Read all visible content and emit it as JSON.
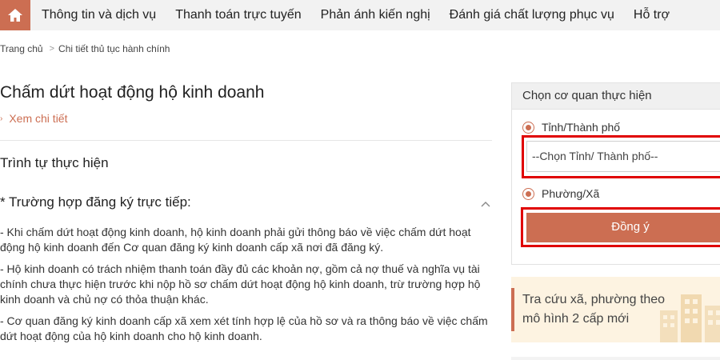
{
  "nav": {
    "items": [
      "Thông tin và dịch vụ",
      "Thanh toán trực tuyến",
      "Phản ánh kiến nghị",
      "Đánh giá chất lượng phục vụ",
      "Hỗ trợ"
    ]
  },
  "breadcrumb": {
    "home": "Trang chủ",
    "current": "Chi tiết thủ tục hành chính"
  },
  "procedure": {
    "title": "Chấm dứt hoạt động hộ kinh doanh",
    "detail_link": "Xem chi tiết",
    "section_title": "Trình tự thực hiện",
    "case_title": "* Trường hợp đăng ký trực tiếp:",
    "paragraphs": [
      "- Khi chấm dứt hoạt động kinh doanh, hộ kinh doanh phải gửi thông báo về việc chấm dứt hoạt động hộ kinh doanh đến Cơ quan đăng ký kinh doanh cấp xã nơi đã đăng ký.",
      "- Hộ kinh doanh có trách nhiệm thanh toán đầy đủ các khoản nợ, gồm cả nợ thuế và nghĩa vụ tài chính chưa thực hiện trước khi nộp hồ sơ chấm dứt hoạt động hộ kinh doanh, trừ trường hợp hộ kinh doanh và chủ nợ có thỏa thuận khác.",
      "- Cơ quan đăng ký kinh doanh cấp xã xem xét tính hợp lệ của hồ sơ và ra thông báo về việc chấm dứt hoạt động của hộ kinh doanh cho hộ kinh doanh."
    ]
  },
  "agency_panel": {
    "header": "Chọn cơ quan thực hiện",
    "option_province": "Tỉnh/Thành phố",
    "select_placeholder": "--Chọn Tỉnh/ Thành phố--",
    "option_ward": "Phường/Xã",
    "agree_button": "Đồng ý"
  },
  "promo": {
    "text": "Tra cứu xã, phường theo mô hình 2 cấp mới"
  },
  "colors": {
    "accent": "#cc6e52",
    "highlight_box": "#e00000",
    "promo_bg": "#fdf3e1",
    "nav_bg": "#f2f2f2"
  },
  "icons": {
    "home": "home-icon",
    "collapse": "chevron-up-icon",
    "detail": "chevron-right-icon"
  }
}
